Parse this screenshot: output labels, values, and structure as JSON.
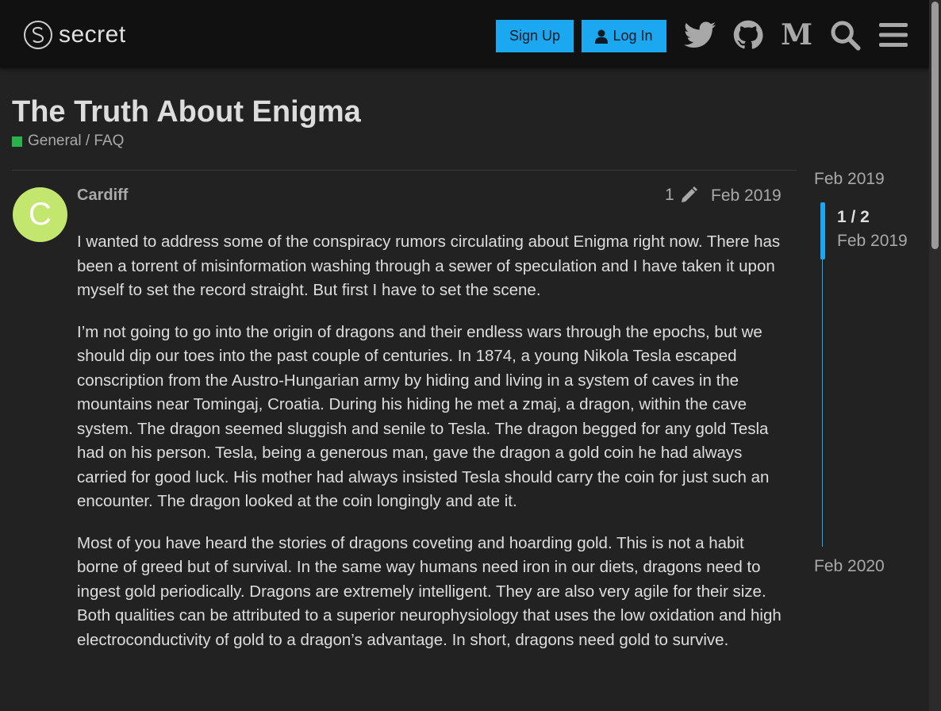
{
  "header": {
    "logo_text": "secret",
    "signup_label": "Sign Up",
    "login_label": "Log In",
    "icons": [
      "twitter-icon",
      "github-icon",
      "medium-icon",
      "search-icon",
      "menu-icon"
    ],
    "medium_glyph": "M",
    "accent_color": "#1ba8f0"
  },
  "topic": {
    "title": "The Truth About Enigma",
    "category": "General / FAQ",
    "category_color": "#2bb34b"
  },
  "post": {
    "avatar_letter": "C",
    "avatar_color": "#c3e66f",
    "username": "Cardiff",
    "edit_count": "1",
    "date": "Feb 2019",
    "paragraphs": [
      "I wanted to address some of the conspiracy rumors circulating about Enigma right now. There has been a torrent of misinformation washing through a sewer of speculation and I have taken it upon myself to set the record straight. But first I have to set the scene.",
      "I’m not going to go into the origin of dragons and their endless wars through the epochs, but we should dip our toes into the past couple of centuries. In 1874, a young Nikola Tesla escaped conscription from the Austro-Hungarian army by hiding and living in a system of caves in the mountains near Tomingaj, Croatia. During his hiding he met a zmaj, a dragon, within the cave system. The dragon seemed sluggish and senile to Tesla. The dragon begged for any gold Tesla had on his person. Tesla, being a generous man, gave the dragon a gold coin he had always carried for good luck. His mother had always insisted Tesla should carry the coin for just such an encounter. The dragon looked at the coin longingly and ate it.",
      "Most of you have heard the stories of dragons coveting and hoarding gold. This is not a habit borne of greed but of survival. In the same way humans need iron in our diets, dragons need to ingest gold periodically. Dragons are extremely intelligent. They are also very agile for their size. Both qualities can be attributed to a superior neurophysiology that uses the low oxidation and high electroconductivity of gold to a dragon’s advantage. In short, dragons need gold to survive."
    ]
  },
  "timeline": {
    "start_date": "Feb 2019",
    "position": "1 / 2",
    "position_date": "Feb 2019",
    "end_date": "Feb 2020"
  }
}
